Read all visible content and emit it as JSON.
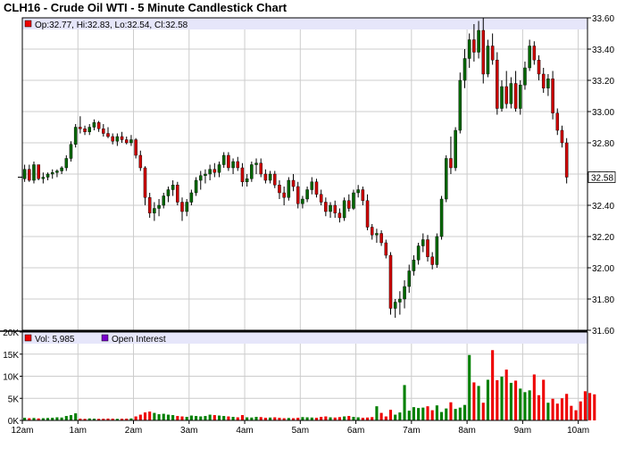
{
  "chart_data": {
    "type": "candlestick",
    "title": "CLH16 - Crude Oil WTI - 5 Minute Candlestick Chart",
    "colors": {
      "up": "#006600",
      "down": "#cc0000",
      "flat": "#0000cc",
      "volume_up": "#008000",
      "volume_down": "#ee0000",
      "open_interest": "#7a00cc",
      "legend_band": "#e6e6fa",
      "grid": "#cccccc",
      "frame": "#000000"
    },
    "price_panel": {
      "ylim": [
        31.6,
        33.6
      ],
      "yticks": [
        "33.60",
        "33.40",
        "33.20",
        "33.00",
        "32.80",
        "32.60",
        "32.40",
        "32.20",
        "32.00",
        "31.80",
        "31.60"
      ],
      "ytick_values": [
        33.6,
        33.4,
        33.2,
        33.0,
        32.8,
        32.6,
        32.4,
        32.2,
        32.0,
        31.8,
        31.6
      ],
      "last_price_label": "32.58",
      "last_price": 32.58,
      "legend": "Op:32.77, Hi:32.83, Lo:32.54, Cl:32.58",
      "grid": true
    },
    "volume_panel": {
      "ylim": [
        0,
        20000
      ],
      "yticks": [
        "20K",
        "15K",
        "10K",
        "5K",
        "0K"
      ],
      "ytick_values": [
        20000,
        15000,
        10000,
        5000,
        0
      ],
      "legend_volume": "Vol: 5,985",
      "legend_oi": "Open Interest",
      "grid": true
    },
    "x_axis": {
      "labels": [
        "12am",
        "1am",
        "2am",
        "3am",
        "4am",
        "5am",
        "6am",
        "7am",
        "8am",
        "9am",
        "10am"
      ],
      "label_index": [
        0,
        12,
        24,
        36,
        48,
        60,
        72,
        84,
        96,
        108,
        120
      ],
      "bars_total": 122
    },
    "candles": [
      [
        32.57,
        32.66,
        32.55,
        32.63
      ],
      [
        32.63,
        32.66,
        32.55,
        32.56
      ],
      [
        32.56,
        32.68,
        32.54,
        32.66
      ],
      [
        32.66,
        32.66,
        32.56,
        32.57
      ],
      [
        32.57,
        32.61,
        32.54,
        32.58
      ],
      [
        32.58,
        32.61,
        32.56,
        32.6
      ],
      [
        32.6,
        32.63,
        32.57,
        32.61
      ],
      [
        32.61,
        32.63,
        32.58,
        32.62
      ],
      [
        32.62,
        32.65,
        32.6,
        32.64
      ],
      [
        32.64,
        32.72,
        32.62,
        32.7
      ],
      [
        32.7,
        32.81,
        32.68,
        32.79
      ],
      [
        32.79,
        32.92,
        32.77,
        32.9
      ],
      [
        32.9,
        32.97,
        32.86,
        32.89
      ],
      [
        32.89,
        32.91,
        32.85,
        32.87
      ],
      [
        32.87,
        32.92,
        32.85,
        32.9
      ],
      [
        32.9,
        32.95,
        32.88,
        32.93
      ],
      [
        32.93,
        32.94,
        32.87,
        32.89
      ],
      [
        32.89,
        32.92,
        32.84,
        32.86
      ],
      [
        32.86,
        32.9,
        32.83,
        32.84
      ],
      [
        32.84,
        32.86,
        32.79,
        32.81
      ],
      [
        32.81,
        32.86,
        32.78,
        32.84
      ],
      [
        32.84,
        32.87,
        32.8,
        32.82
      ],
      [
        32.82,
        32.84,
        32.79,
        32.8
      ],
      [
        32.8,
        32.85,
        32.78,
        32.82
      ],
      [
        32.82,
        32.83,
        32.7,
        32.72
      ],
      [
        32.72,
        32.75,
        32.62,
        32.64
      ],
      [
        32.64,
        32.65,
        32.4,
        32.45
      ],
      [
        32.45,
        32.48,
        32.32,
        32.35
      ],
      [
        32.35,
        32.42,
        32.3,
        32.38
      ],
      [
        32.38,
        32.44,
        32.33,
        32.4
      ],
      [
        32.4,
        32.48,
        32.38,
        32.46
      ],
      [
        32.46,
        32.52,
        32.42,
        32.5
      ],
      [
        32.5,
        32.56,
        32.46,
        32.53
      ],
      [
        32.53,
        32.55,
        32.4,
        32.42
      ],
      [
        32.42,
        32.45,
        32.3,
        32.36
      ],
      [
        32.36,
        32.44,
        32.33,
        32.42
      ],
      [
        32.42,
        32.5,
        32.4,
        32.48
      ],
      [
        32.48,
        32.58,
        32.46,
        32.56
      ],
      [
        32.56,
        32.62,
        32.5,
        32.59
      ],
      [
        32.59,
        32.63,
        32.54,
        32.6
      ],
      [
        32.6,
        32.66,
        32.56,
        32.63
      ],
      [
        32.63,
        32.67,
        32.58,
        32.61
      ],
      [
        32.61,
        32.68,
        32.58,
        32.66
      ],
      [
        32.66,
        32.74,
        32.64,
        32.72
      ],
      [
        32.72,
        32.74,
        32.62,
        32.64
      ],
      [
        32.64,
        32.7,
        32.6,
        32.68
      ],
      [
        32.68,
        32.71,
        32.62,
        32.64
      ],
      [
        32.64,
        32.67,
        32.52,
        32.55
      ],
      [
        32.55,
        32.6,
        32.52,
        32.57
      ],
      [
        32.57,
        32.68,
        32.55,
        32.66
      ],
      [
        32.66,
        32.7,
        32.6,
        32.67
      ],
      [
        32.67,
        32.7,
        32.58,
        32.6
      ],
      [
        32.6,
        32.63,
        32.54,
        32.56
      ],
      [
        32.56,
        32.62,
        32.54,
        32.6
      ],
      [
        32.6,
        32.62,
        32.51,
        32.53
      ],
      [
        32.53,
        32.56,
        32.44,
        32.48
      ],
      [
        32.48,
        32.52,
        32.4,
        32.45
      ],
      [
        32.45,
        32.58,
        32.43,
        32.56
      ],
      [
        32.56,
        32.6,
        32.49,
        32.52
      ],
      [
        32.52,
        32.55,
        32.38,
        32.41
      ],
      [
        32.41,
        32.46,
        32.38,
        32.44
      ],
      [
        32.44,
        32.52,
        32.42,
        32.5
      ],
      [
        32.5,
        32.58,
        32.47,
        32.55
      ],
      [
        32.55,
        32.57,
        32.45,
        32.47
      ],
      [
        32.47,
        32.5,
        32.4,
        32.42
      ],
      [
        32.42,
        32.45,
        32.33,
        32.36
      ],
      [
        32.36,
        32.42,
        32.32,
        32.4
      ],
      [
        32.4,
        32.43,
        32.32,
        32.35
      ],
      [
        32.35,
        32.38,
        32.29,
        32.32
      ],
      [
        32.32,
        32.45,
        32.3,
        32.43
      ],
      [
        32.43,
        32.47,
        32.36,
        32.38
      ],
      [
        32.38,
        32.5,
        32.37,
        32.48
      ],
      [
        32.48,
        32.53,
        32.45,
        32.5
      ],
      [
        32.5,
        32.52,
        32.4,
        32.43
      ],
      [
        32.43,
        32.47,
        32.24,
        32.26
      ],
      [
        32.26,
        32.28,
        32.18,
        32.21
      ],
      [
        32.21,
        32.25,
        32.16,
        32.22
      ],
      [
        32.22,
        32.24,
        32.14,
        32.16
      ],
      [
        32.16,
        32.18,
        32.06,
        32.08
      ],
      [
        32.08,
        32.1,
        31.7,
        31.74
      ],
      [
        31.74,
        31.8,
        31.68,
        31.78
      ],
      [
        31.78,
        31.85,
        31.7,
        31.8
      ],
      [
        31.8,
        31.92,
        31.74,
        31.88
      ],
      [
        31.88,
        32.02,
        31.84,
        31.98
      ],
      [
        31.98,
        32.08,
        31.95,
        32.05
      ],
      [
        32.05,
        32.16,
        32.02,
        32.14
      ],
      [
        32.14,
        32.22,
        32.1,
        32.18
      ],
      [
        32.18,
        32.21,
        32.04,
        32.07
      ],
      [
        32.07,
        32.1,
        31.99,
        32.02
      ],
      [
        32.02,
        32.22,
        32.0,
        32.2
      ],
      [
        32.2,
        32.46,
        32.18,
        32.44
      ],
      [
        32.44,
        32.72,
        32.42,
        32.7
      ],
      [
        32.7,
        32.84,
        32.6,
        32.64
      ],
      [
        32.64,
        32.9,
        32.62,
        32.88
      ],
      [
        32.88,
        33.25,
        32.86,
        33.2
      ],
      [
        33.2,
        33.4,
        33.15,
        33.34
      ],
      [
        33.34,
        33.5,
        33.28,
        33.46
      ],
      [
        33.46,
        33.56,
        33.32,
        33.38
      ],
      [
        33.38,
        33.58,
        33.34,
        33.52
      ],
      [
        33.52,
        33.6,
        33.18,
        33.24
      ],
      [
        33.24,
        33.46,
        33.22,
        33.42
      ],
      [
        33.42,
        33.5,
        33.3,
        33.33
      ],
      [
        33.33,
        33.38,
        32.98,
        33.02
      ],
      [
        33.02,
        33.2,
        33.0,
        33.16
      ],
      [
        33.16,
        33.26,
        33.02,
        33.05
      ],
      [
        33.05,
        33.22,
        33.02,
        33.18
      ],
      [
        33.18,
        33.26,
        33.0,
        33.02
      ],
      [
        33.02,
        33.2,
        32.98,
        33.17
      ],
      [
        33.17,
        33.32,
        33.14,
        33.28
      ],
      [
        33.28,
        33.46,
        33.26,
        33.42
      ],
      [
        33.42,
        33.45,
        33.3,
        33.33
      ],
      [
        33.33,
        33.36,
        33.2,
        33.24
      ],
      [
        33.24,
        33.28,
        33.12,
        33.15
      ],
      [
        33.15,
        33.24,
        33.1,
        33.21
      ],
      [
        33.21,
        33.26,
        32.95,
        32.99
      ],
      [
        32.99,
        33.02,
        32.85,
        32.88
      ],
      [
        32.88,
        32.91,
        32.77,
        32.8
      ],
      [
        32.8,
        32.83,
        32.54,
        32.58
      ]
    ],
    "volumes": [
      600,
      500,
      550,
      450,
      500,
      550,
      600,
      700,
      650,
      1000,
      1200,
      1600,
      400,
      350,
      450,
      400,
      350,
      380,
      420,
      400,
      350,
      380,
      400,
      450,
      900,
      1300,
      1800,
      2000,
      1700,
      1400,
      1500,
      1300,
      1200,
      1000,
      900,
      800,
      1100,
      1000,
      900,
      1000,
      1300,
      1200,
      1100,
      1000,
      900,
      800,
      700,
      1200,
      700,
      650,
      800,
      750,
      600,
      650,
      700,
      600,
      500,
      550,
      500,
      600,
      750,
      700,
      650,
      600,
      800,
      900,
      700,
      650,
      750,
      900,
      1000,
      800,
      700,
      600,
      650,
      750,
      3200,
      1700,
      900,
      2400,
      1300,
      1800,
      8000,
      2200,
      3000,
      2800,
      2900,
      3200,
      2300,
      3400,
      1900,
      2700,
      4100,
      2600,
      2900,
      3500,
      14800,
      8600,
      7800,
      4000,
      9200,
      15900,
      9100,
      9900,
      11500,
      8500,
      9000,
      7200,
      6400,
      6800,
      10400,
      5700,
      9200,
      4000,
      4900,
      3800,
      5000,
      6000,
      3300,
      2300,
      4300,
      6600,
      6200,
      5900
    ]
  }
}
